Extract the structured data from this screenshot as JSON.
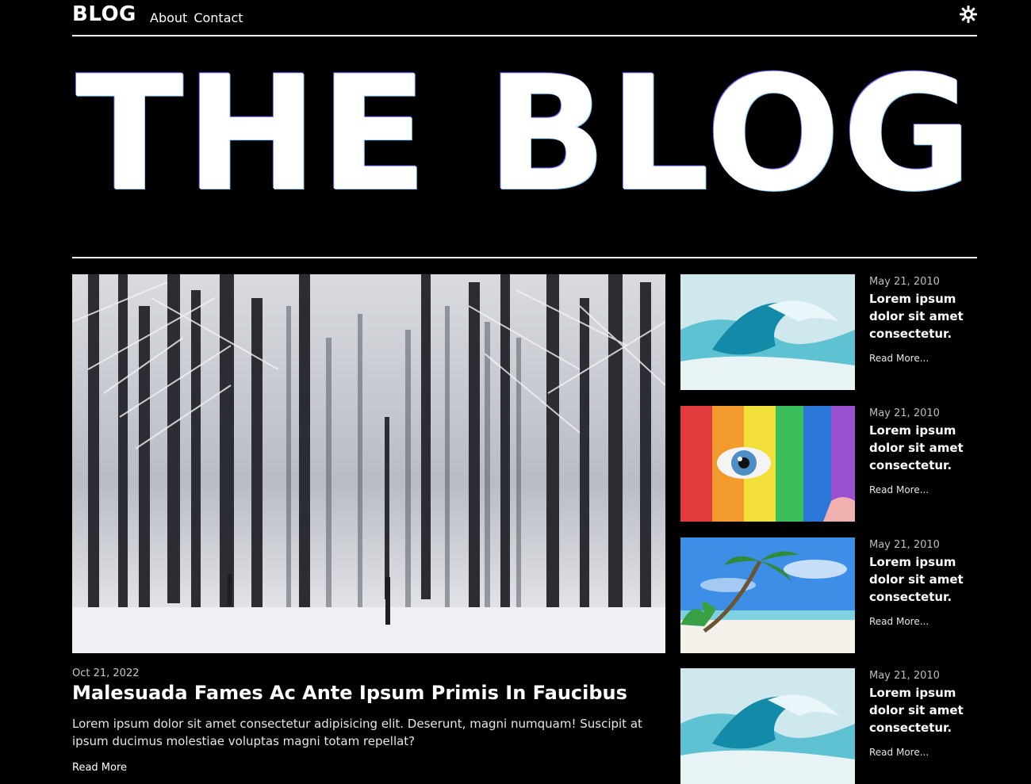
{
  "nav": {
    "logo": "BLOG",
    "links": [
      "About",
      "Contact"
    ]
  },
  "hero": {
    "title": "THE BLOG"
  },
  "featured": {
    "date": "Oct 21, 2022",
    "title": "Malesuada Fames Ac Ante Ipsum Primis In Faucibus",
    "excerpt": "Lorem ipsum dolor sit amet consectetur adipisicing elit. Deserunt, magni numquam! Suscipit at ipsum ducimus molestiae voluptas magni totam repellat?",
    "read_more": "Read More"
  },
  "sidebar": {
    "posts": [
      {
        "date": "May 21, 2010",
        "title": "Lorem ipsum dolor sit amet consectetur.",
        "read_more": "Read More..."
      },
      {
        "date": "May 21, 2010",
        "title": "Lorem ipsum dolor sit amet consectetur.",
        "read_more": "Read More..."
      },
      {
        "date": "May 21, 2010",
        "title": "Lorem ipsum dolor sit amet consectetur.",
        "read_more": "Read More..."
      },
      {
        "date": "May 21, 2010",
        "title": "Lorem ipsum dolor sit amet consectetur.",
        "read_more": "Read More..."
      }
    ]
  },
  "icons": {
    "theme_toggle": "sun-icon"
  },
  "colors": {
    "background": "#000000",
    "text": "#ffffff",
    "muted": "#bdbdbd"
  }
}
